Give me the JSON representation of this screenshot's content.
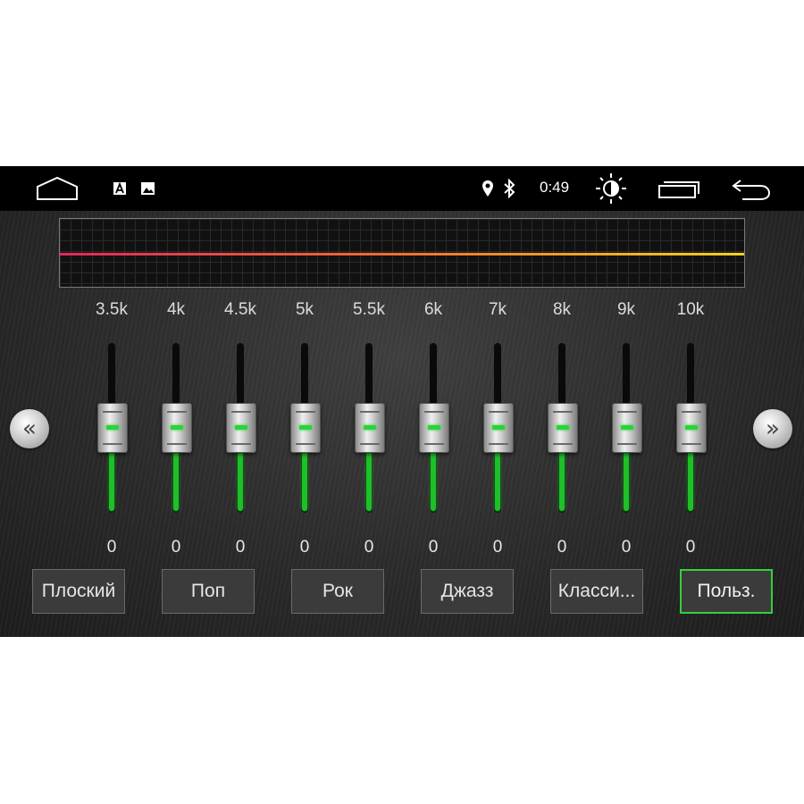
{
  "status_bar": {
    "time": "0:49",
    "icons": [
      "home-icon",
      "app-notification-icon",
      "image-notification-icon",
      "location-icon",
      "bluetooth-icon",
      "brightness-icon",
      "recent-apps-icon",
      "back-icon"
    ]
  },
  "equalizer": {
    "bands": [
      {
        "freq": "3.5k",
        "value": "0"
      },
      {
        "freq": "4k",
        "value": "0"
      },
      {
        "freq": "4.5k",
        "value": "0"
      },
      {
        "freq": "5k",
        "value": "0"
      },
      {
        "freq": "5.5k",
        "value": "0"
      },
      {
        "freq": "6k",
        "value": "0"
      },
      {
        "freq": "7k",
        "value": "0"
      },
      {
        "freq": "8k",
        "value": "0"
      },
      {
        "freq": "9k",
        "value": "0"
      },
      {
        "freq": "10k",
        "value": "0"
      }
    ],
    "prev_glyph": "«",
    "next_glyph": "»"
  },
  "presets": [
    {
      "label": "Плоский",
      "active": false
    },
    {
      "label": "Поп",
      "active": false
    },
    {
      "label": "Рок",
      "active": false
    },
    {
      "label": "Джазз",
      "active": false
    },
    {
      "label": "Класси...",
      "active": false
    },
    {
      "label": "Польз.",
      "active": true
    }
  ],
  "colors": {
    "accent": "#33d13a",
    "curve_start": "#e0285a",
    "curve_end": "#f5d020"
  }
}
